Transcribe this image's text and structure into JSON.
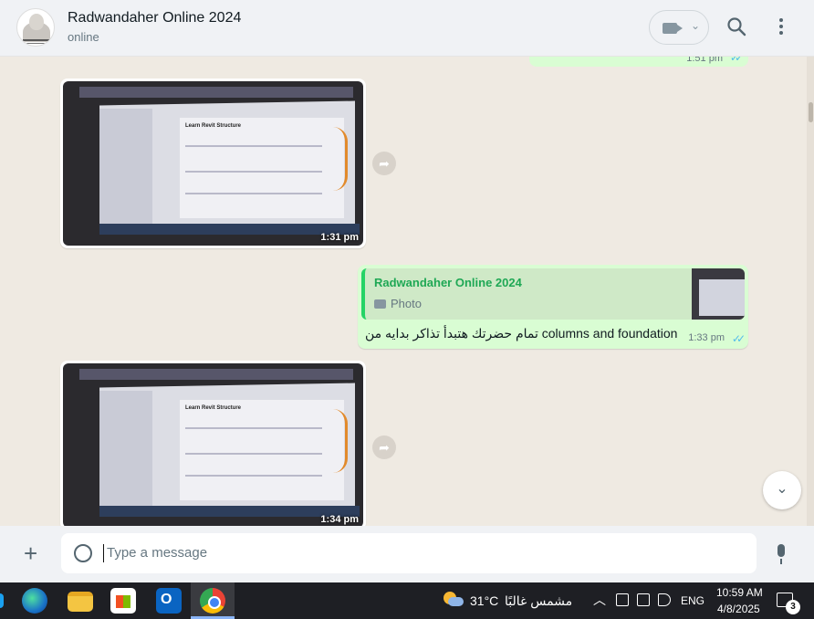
{
  "header": {
    "contact_name": "Radwandaher Online 2024",
    "status": "online",
    "video_chevron": "⌄"
  },
  "messages": {
    "top_fragment_time": "1:51 pm",
    "image1": {
      "time": "1:31 pm",
      "screen_title": "Learn Revit Structure"
    },
    "reply": {
      "quote_name": "Radwandaher Online 2024",
      "quote_type": "Photo",
      "text": "تمام حضرتك هتبدأ تذاكر بدايه من columns and foundation",
      "time": "1:33 pm"
    },
    "image2": {
      "time": "1:34 pm",
      "screen_title": "Learn Revit Structure"
    }
  },
  "composer": {
    "placeholder": "Type a message"
  },
  "taskbar": {
    "temperature": "31°C",
    "weather": "مشمس غالبًا",
    "language": "ENG",
    "time": "10:59 AM",
    "date": "4/8/2025",
    "notifications": "3"
  },
  "colors": {
    "outgoing_bubble": "#d9fdd3",
    "incoming_bubble": "#ffffff",
    "chat_bg": "#efeae2",
    "read_ticks": "#53bdeb",
    "quote_accent": "#25d366"
  }
}
